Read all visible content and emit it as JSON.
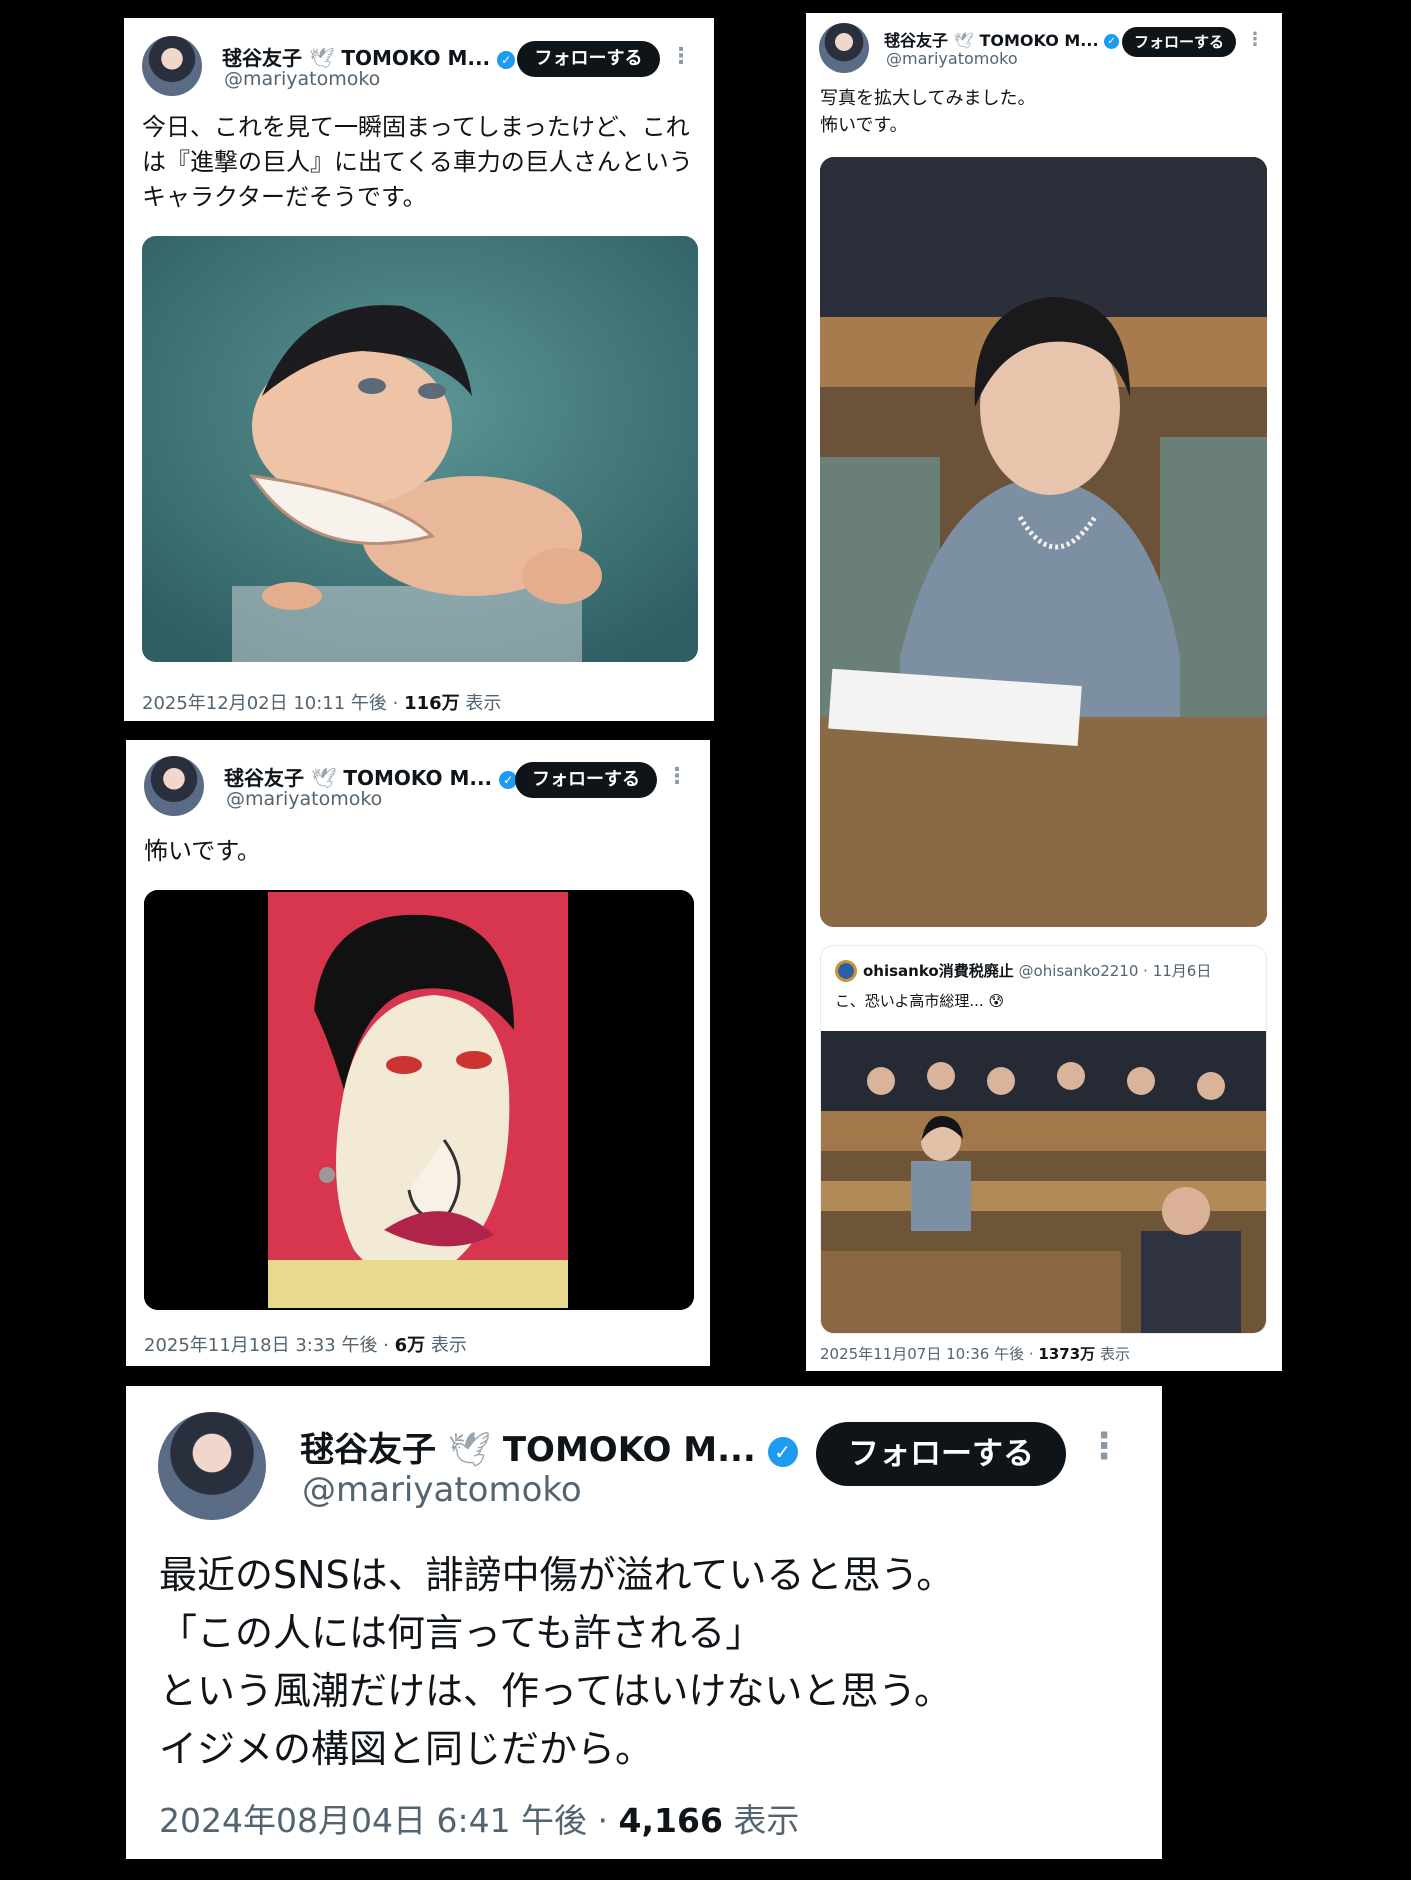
{
  "tweets": [
    {
      "name": "毬谷友子",
      "dove": "🕊",
      "name_en": "TOMOKO M...",
      "verified_mark": "✓",
      "handle": "@mariyatomoko",
      "follow_label": "フォローする",
      "more": "⋮",
      "text": "今日、これを見て一瞬固まってしまったけど、これは『進撃の巨人』に出てくる車力の巨人さんというキャラクターだそうです。",
      "date": "2025年12月02日 10:11 午後 · ",
      "views": "116万",
      "views_label": " 表示",
      "image": "figure-photo"
    },
    {
      "name": "毬谷友子",
      "dove": "🕊",
      "name_en": "TOMOKO M...",
      "verified_mark": "✓",
      "handle": "@mariyatomoko",
      "follow_label": "フォローする",
      "more": "⋮",
      "text": "怖いです。",
      "date": "2025年11月18日 3:33 午後 · ",
      "views": "6万",
      "views_label": " 表示",
      "image": "caricature-painting"
    },
    {
      "name": "毬谷友子",
      "dove": "🕊",
      "name_en": "TOMOKO M...",
      "verified_mark": "✓",
      "handle": "@mariyatomoko",
      "follow_label": "フォローする",
      "more": "⋮",
      "text": "写真を拡大してみました。\n怖いです。",
      "date": "2025年11月07日 10:36 午後 · ",
      "views": "1373万",
      "views_label": " 表示",
      "image": "parliament-photo",
      "quote": {
        "name": "ohisanko消費税廃止",
        "handle": "@ohisanko2210 · 11月6日",
        "text": "こ、恐いよ高市総理...",
        "emoji": "😰",
        "image": "parliament-wide-photo"
      }
    },
    {
      "name": "毬谷友子",
      "dove": "🕊",
      "name_en": "TOMOKO M...",
      "verified_mark": "✓",
      "handle": "@mariyatomoko",
      "follow_label": "フォローする",
      "more": "⋮",
      "text": "最近のSNSは、誹謗中傷が溢れていると思う。\n「この人には何言っても許される」\nという風潮だけは、作ってはいけないと思う。\nイジメの構図と同じだから。",
      "date": "2024年08月04日 6:41 午後 · ",
      "views": "4,166",
      "views_label": " 表示"
    }
  ],
  "colors": {
    "follow_bg": "#0f1419",
    "verified": "#1d9bf0",
    "muted": "#536471"
  }
}
